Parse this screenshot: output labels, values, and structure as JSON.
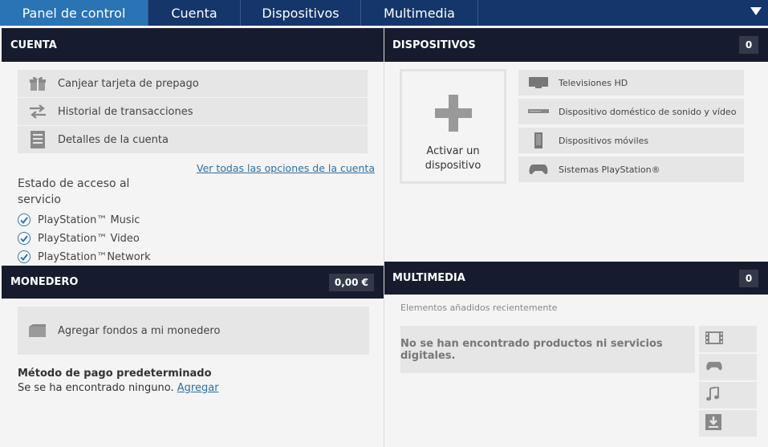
{
  "nav": {
    "tabs": [
      {
        "label": "Panel de control",
        "active": true
      },
      {
        "label": "Cuenta"
      },
      {
        "label": "Dispositivos"
      },
      {
        "label": "Multimedia"
      }
    ],
    "menu_icon": "chevron-down-icon"
  },
  "cuenta": {
    "header": "CUENTA",
    "items": [
      {
        "label": "Canjear tarjeta de prepago",
        "icon": "gift-icon"
      },
      {
        "label": "Historial de transacciones",
        "icon": "transfer-arrows-icon"
      },
      {
        "label": "Detalles de la cuenta",
        "icon": "document-icon"
      }
    ],
    "all_options_link": "Ver todas las opciones de la cuenta",
    "status_title": "Estado de acceso al servicio",
    "services": [
      "PlayStation™ Music",
      "PlayStation™ Video",
      "PlayStation™Network"
    ]
  },
  "monedero": {
    "header": "MONEDERO",
    "balance": "0,00 €",
    "add_funds": "Agregar fondos a mi monedero",
    "payment_title": "Método de pago predeterminado",
    "payment_none": "Se se ha encontrado ninguno.",
    "payment_add": "Agregar"
  },
  "dispositivos": {
    "header": "DISPOSITIVOS",
    "count": "0",
    "activate": "Activar un dispositivo",
    "types": [
      {
        "label": "Televisiones HD",
        "icon": "tv-icon"
      },
      {
        "label": "Dispositivo doméstico de sonido y vídeo",
        "icon": "av-device-icon"
      },
      {
        "label": "Dispositivos móviles",
        "icon": "mobile-icon"
      },
      {
        "label": "Sistemas PlayStation®",
        "icon": "gamepad-icon"
      }
    ]
  },
  "multimedia": {
    "header": "MULTIMEDIA",
    "count": "0",
    "recent_label": "Elementos añadidos recientemente",
    "empty_message": "No se han encontrado productos ni servicios digitales.",
    "filter_icons": [
      "film-icon",
      "gamepad-icon",
      "music-note-icon",
      "download-icon"
    ]
  },
  "colors": {
    "nav_bg": "#14366a",
    "nav_active": "#2a73b5",
    "header_bg": "#161c2d",
    "link": "#2f6f9f"
  }
}
